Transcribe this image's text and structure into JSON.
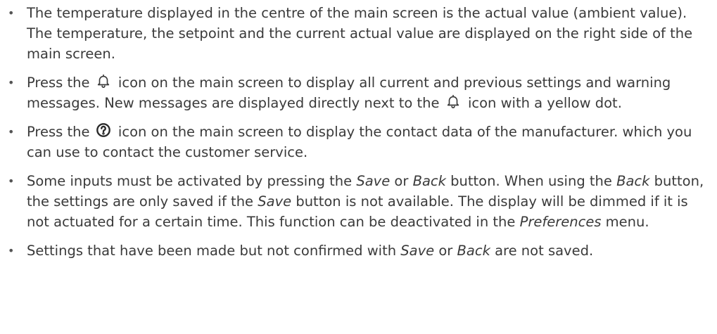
{
  "bullet_char": "•",
  "paragraphs": [
    {
      "text": "The temperature displayed in the centre of the main screen is the actual value (ambient value). The temperature, the setpoint and the current actual value are displayed on the right side of the main screen."
    },
    {
      "t1": "Press the ",
      "t2": " icon on the main screen to display all current and previous settings and warning messages. New messages are displayed directly next to the ",
      "t3": " icon with a yellow dot."
    },
    {
      "t1": "Press the ",
      "t2": " icon on the main screen to display the contact data of the manufacturer. which you can use to contact the customer service."
    },
    {
      "t1": "Some inputs must be activated by pressing the ",
      "save": "Save",
      "t2": " or ",
      "back": "Back",
      "t3": " button. When using the ",
      "back2": "Back",
      "t4": " button, the settings are only saved if the ",
      "save2": "Save",
      "t5": " button is not available. The display will be dimmed if it is not actuated for a certain time. This function can be deactivated in the ",
      "prefs": "Preferences",
      "t6": " menu."
    },
    {
      "t1": "Settings that have been made but not confirmed with ",
      "save": "Save",
      "t2": " or ",
      "back": "Back",
      "t3": " are not saved."
    }
  ],
  "icons": {
    "bell": "bell-icon",
    "help": "help-icon"
  }
}
